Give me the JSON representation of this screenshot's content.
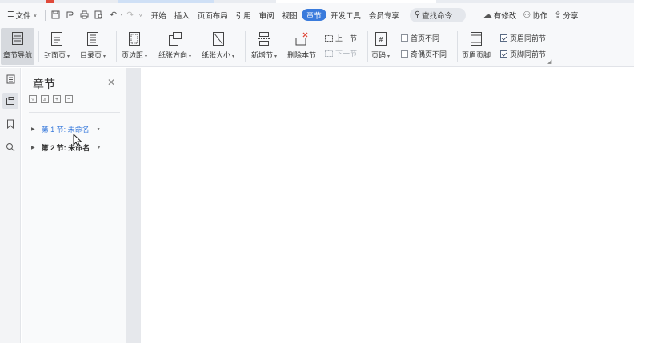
{
  "menubar": {
    "file_label": "文件",
    "tabs": [
      {
        "label": "开始"
      },
      {
        "label": "插入"
      },
      {
        "label": "页面布局"
      },
      {
        "label": "引用"
      },
      {
        "label": "审阅"
      },
      {
        "label": "视图"
      },
      {
        "label": "章节",
        "active": true
      },
      {
        "label": "开发工具"
      },
      {
        "label": "会员专享"
      }
    ],
    "search_label": "查找命令...",
    "changes_label": "有修改",
    "collab_label": "协作",
    "share_label": "分享"
  },
  "ribbon": {
    "nav_pane": "章节导航",
    "cover": "封面页",
    "toc": "目录页",
    "margins": "页边距",
    "orientation": "纸张方向",
    "size": "纸张大小",
    "new_section": "新增节",
    "delete_section": "删除本节",
    "prev_section": "上一节",
    "next_section": "下一节",
    "page_number": "页码",
    "first_page_diff": "首页不同",
    "odd_even_diff": "奇偶页不同",
    "header_footer": "页眉页脚",
    "header_same": "页眉同前节",
    "footer_same": "页脚同前节"
  },
  "nav_panel": {
    "title": "章节",
    "sections": [
      {
        "label": "第 1 节: 未命名",
        "current": true
      },
      {
        "label": "第 2 节: 未命名",
        "current": false
      }
    ]
  },
  "colors": {
    "accent": "#3a7bdc",
    "ribbon_bg": "#f7f8fa",
    "gutter": "#e6e8ec"
  }
}
